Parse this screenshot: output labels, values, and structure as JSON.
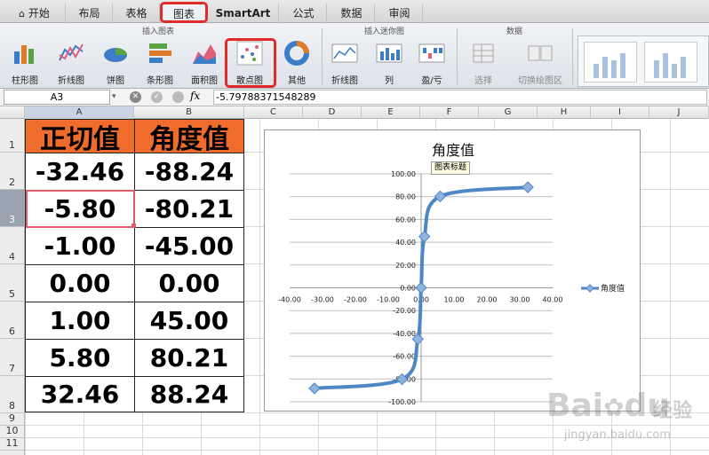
{
  "tabs": [
    {
      "label": "开始",
      "icon": "home-icon"
    },
    {
      "label": "布局"
    },
    {
      "label": "表格"
    },
    {
      "label": "图表"
    },
    {
      "label": "SmartArt"
    },
    {
      "label": "公式"
    },
    {
      "label": "数据"
    },
    {
      "label": "审阅"
    }
  ],
  "ribbon": {
    "groups": {
      "insert_chart": "插入图表",
      "insert_sparkline": "插入迷你图",
      "data": "数据"
    },
    "buttons": {
      "column": "柱形图",
      "line": "折线图",
      "pie": "饼图",
      "bar": "条形图",
      "area": "面积图",
      "scatter": "散点图",
      "other": "其他",
      "spark_line": "折线图",
      "spark_column": "列",
      "spark_winloss": "盈/亏",
      "select": "选择",
      "switch": "切换绘图区"
    }
  },
  "formula_bar": {
    "name_box": "A3",
    "fx": "fx",
    "value": "-5.79788371548289"
  },
  "columns": [
    "A",
    "B",
    "C",
    "D",
    "E",
    "F",
    "G",
    "H",
    "I",
    "J"
  ],
  "rows": [
    "1",
    "2",
    "3",
    "4",
    "5",
    "6",
    "7",
    "8",
    "9",
    "10",
    "11"
  ],
  "table": {
    "headers": [
      "正切值",
      "角度值"
    ],
    "rows": [
      [
        "-32.46",
        "-88.24"
      ],
      [
        "-5.80",
        "-80.21"
      ],
      [
        "-1.00",
        "-45.00"
      ],
      [
        "0.00",
        "0.00"
      ],
      [
        "1.00",
        "45.00"
      ],
      [
        "5.80",
        "80.21"
      ],
      [
        "32.46",
        "88.24"
      ]
    ]
  },
  "tooltip": "图表标题",
  "watermark": {
    "brand": "Bai",
    "brand2": "du",
    "cn": "经验",
    "url": "jingyan.baidu.com"
  },
  "chart_data": {
    "type": "scatter",
    "title": "角度值",
    "series": [
      {
        "name": "角度值",
        "x": [
          -32.46,
          -5.8,
          -1.0,
          0.0,
          1.0,
          5.8,
          32.46
        ],
        "y": [
          -88.24,
          -80.21,
          -45.0,
          0.0,
          45.0,
          80.21,
          88.24
        ],
        "color": "#4e86c6"
      }
    ],
    "xlim": [
      -40,
      40
    ],
    "xticks": [
      "-40.00",
      "-30.00",
      "-20.00",
      "-10.00",
      "0.00",
      "10.00",
      "20.00",
      "30.00",
      "40.00"
    ],
    "ylim": [
      -100,
      100
    ],
    "yticks": [
      "100.00",
      "80.00",
      "60.00",
      "40.00",
      "20.00",
      "0.00",
      "-20.00",
      "-40.00",
      "-60.00",
      "-80.00",
      "-100.00"
    ],
    "grid": true,
    "legend": "right",
    "smooth": true
  }
}
